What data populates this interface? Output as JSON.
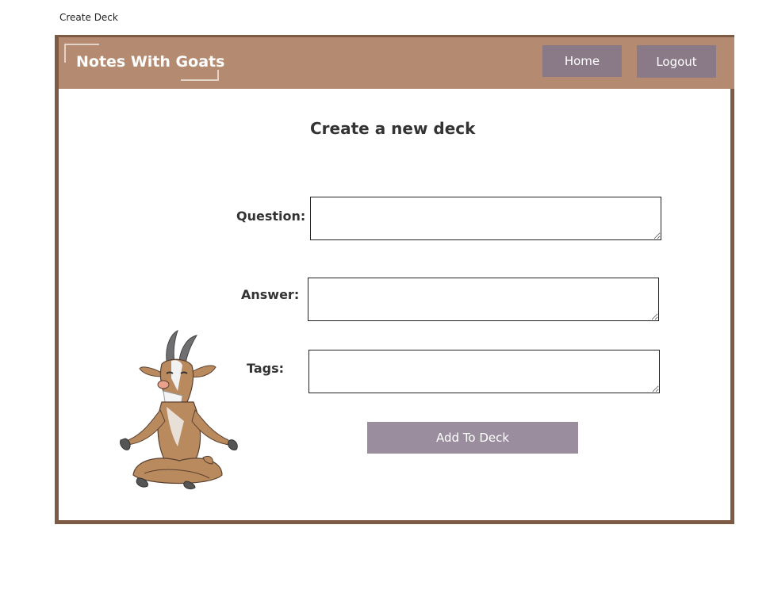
{
  "document": {
    "title": "Create Deck"
  },
  "header": {
    "brand": "Notes With Goats",
    "nav": {
      "home_label": "Home",
      "logout_label": "Logout"
    }
  },
  "form": {
    "title": "Create a new deck",
    "question": {
      "label": "Question:",
      "value": "",
      "placeholder": ""
    },
    "answer": {
      "label": "Answer:",
      "value": "",
      "placeholder": ""
    },
    "tags": {
      "label": "Tags:",
      "value": "",
      "placeholder": ""
    },
    "submit_label": "Add To Deck"
  },
  "mascot": {
    "icon": "meditating-goat-illustration"
  },
  "colors": {
    "frame_border": "#7d5a44",
    "header_bg": "#b48b70",
    "nav_button_bg": "#8a7a87",
    "submit_button_bg": "#9a8e9e"
  }
}
